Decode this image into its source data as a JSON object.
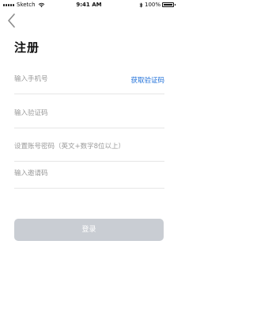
{
  "status_bar": {
    "carrier": "Sketch",
    "time": "9:41 AM",
    "battery_text": "100%",
    "battery_level": 1.0
  },
  "icons": {
    "back": "chevron-left-icon",
    "wifi": "wifi-icon",
    "bluetooth": "bluetooth-icon",
    "battery": "battery-icon"
  },
  "page": {
    "title": "注册"
  },
  "form": {
    "phone_placeholder": "输入手机号",
    "get_code_label": "获取验证码",
    "code_placeholder": "输入验证码",
    "password_placeholder": "设置账号密码（英文+数字8位以上）",
    "invite_placeholder": "输入邀请码"
  },
  "actions": {
    "login_label": "登录"
  },
  "colors": {
    "accent": "#1e6fd9",
    "button_disabled": "#c9cdd3",
    "divider": "#e6e6e6",
    "placeholder": "#9a9a9a"
  }
}
